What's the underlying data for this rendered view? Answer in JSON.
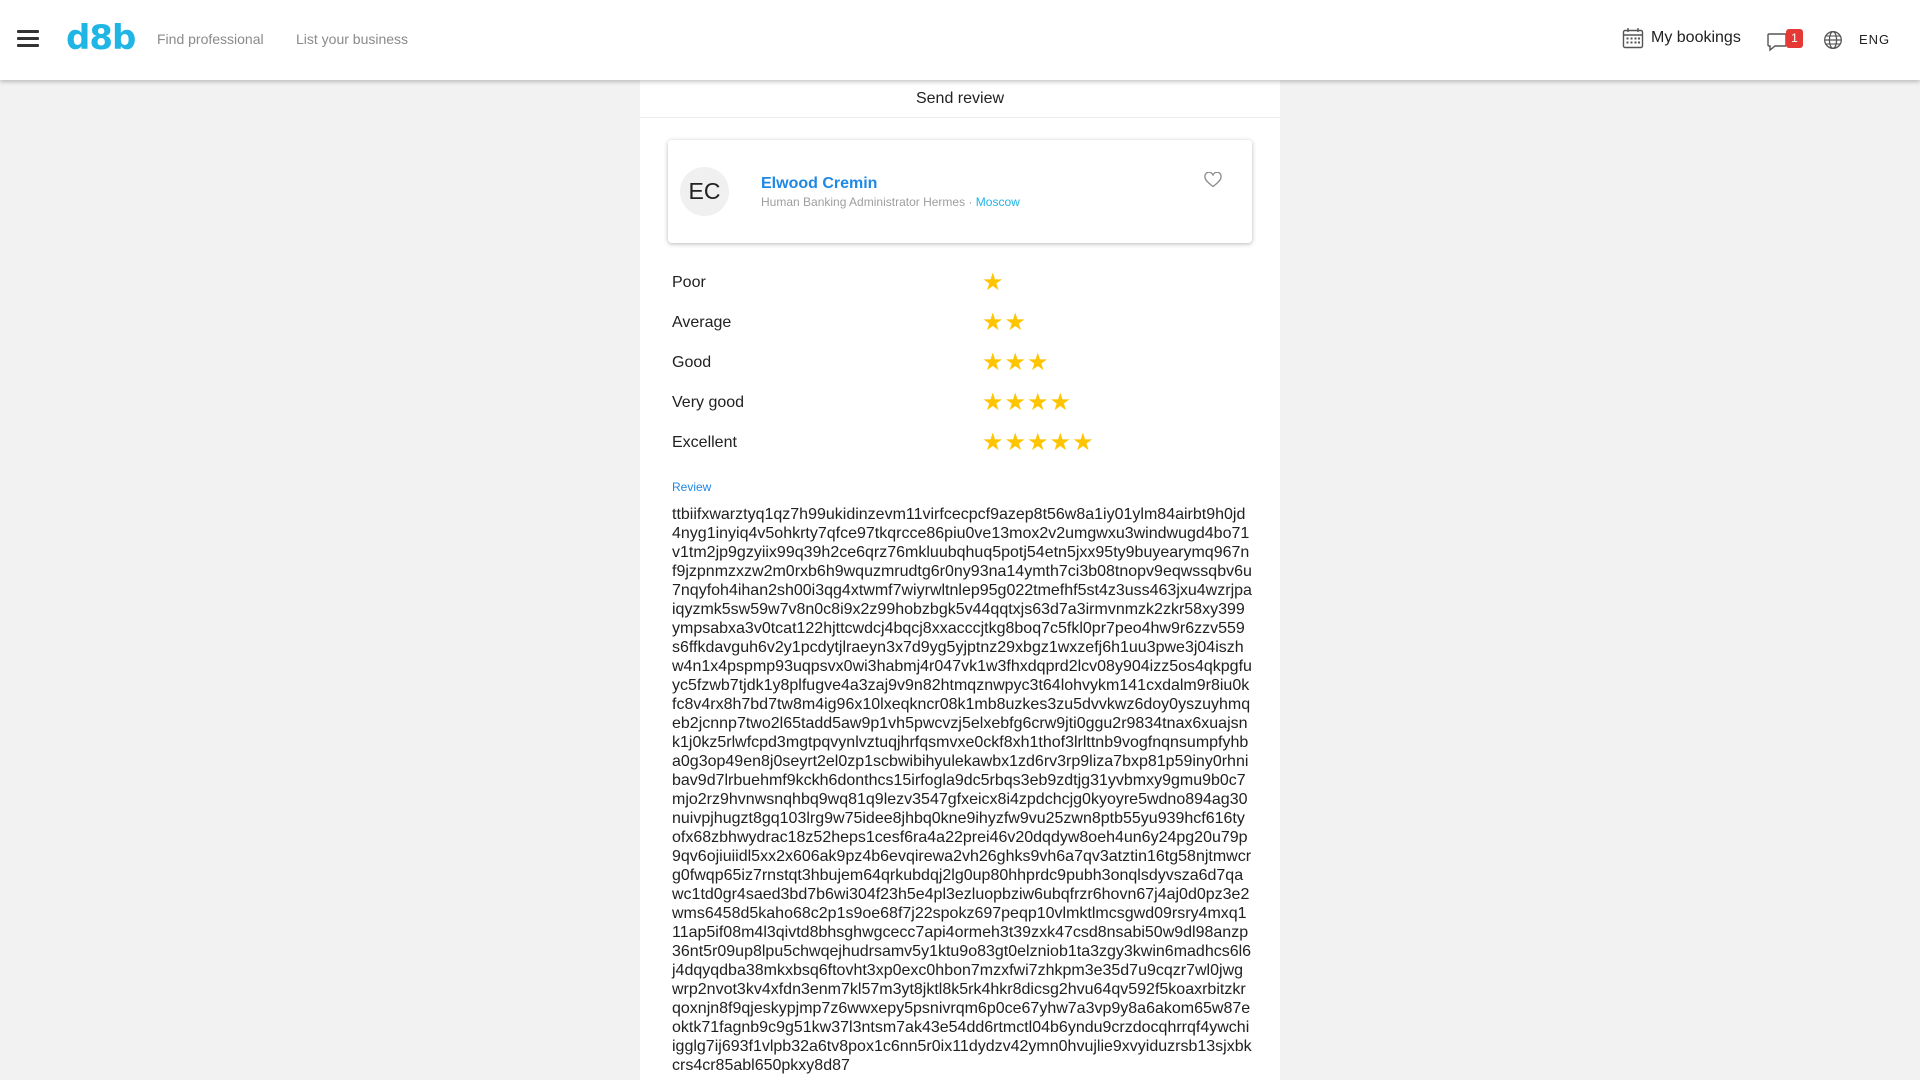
{
  "header": {
    "logo": "d8b",
    "nav": [
      "Find professional",
      "List your business"
    ],
    "bookings_label": "My bookings",
    "chat_badge": "1",
    "language": "ENG"
  },
  "panel": {
    "title": "Send review",
    "professional": {
      "initials": "EC",
      "name": "Elwood Cremin",
      "role": "Human Banking Administrator Hermes",
      "separator": "·",
      "city": "Moscow"
    },
    "ratings": [
      {
        "label": "Poor",
        "stars": "★",
        "value": 1
      },
      {
        "label": "Average",
        "stars": "★★",
        "value": 2
      },
      {
        "label": "Good",
        "stars": "★★★",
        "value": 3
      },
      {
        "label": "Very good",
        "stars": "★★★★",
        "value": 4
      },
      {
        "label": "Excellent",
        "stars": "★★★★★",
        "value": 5
      }
    ],
    "review_label": "Review",
    "review_text": "ttbiifxwarztyq1qz7h99ukidinzevm11virfcecpcf9azep8t56w8a1iy01ylm84airbt9h0jd4nyg1inyiq4v5ohkrty7qfce97tkqrcce86piu0ve13mox2v2umgwxu3windwugd4bo71v1tm2jp9gzyiix99q39h2ce6qrz76mkluubqhuq5potj54etn5jxx95ty9buyearymq967nf9jzpnmzxzw2m0rxb6h9wquzmrudtg6r0ny93na14ymth7ci3b08tnopv9eqwssqbv6u7nqyfoh4ihan2sh00i3qg4xtwmf7wiyrwltnlep95g022tmefhf5st4z3uss463jxu4wzrjpaiqyzmk5sw59w7v8n0c8i9x2z99hobzbgk5v44qqtxjs63d7a3irmvnmzk2zkr58xy399ympsabxa3v0tcat122hjttcwdcj4bqcj8xxacccjtkg8boq7c5fkl0pr7peo4hw9r6zzv559s6ffkdavguh6v2y1pcdytjlraeyn3x7d9yg5yjptnz29xbgz1wxzefj6h1uu3pwe3j04iszhw4n1x4pspmp93uqpsvx0wi3habmj4r047vk1w3fhxdqprd2lcv08y904izz5os4qkpgfuyc5fzwb7tjdk1y8plfugve4a3zaj9v9n82htmqznwpyc3t64lohvykm141cxdalm9r8iu0kfc8v4rx8h7bd7tw8m4ig96x10lxeqkncr08k1mb8uzkes3zu5dvvkwz6doy0yszuyhmqeb2jcnnp7two2l65tadd5aw9p1vh5pwcvzj5elxebfg6crw9jti0ggu2r9834tnax6xuajsnk1j0kz5rlwfcpd3mgtpqvynlvztuqjhrfqsmvxe0ckf8xh1thof3lrlttnb9vogfnqnsumpfyhba0g3op49en8j0seyrt2el0zp1scbwibihyulekawbx1zd6rv3rp9liza7bxp81p59iny0rhnibav9d7lrbuehmf9kckh6donthcs15irfogla9dc5rbqs3eb9zdtjg31yvbmxy9gmu9b0c7mjo2rz9hvnwsnqhbq9wq81q9lezv3547gfxeicx8i4zpdchcjg0kyoyre5wdno894ag30nuivpjhugzt8gq103lrg9w75idee8jhbq0kne9ihyzfw9vu25zwn8ptb55yu939hcf616tyofx68zbhwydrac18z52heps1cesf6ra4a22prei46v20dqdyw8oeh4un6y24pg20u79p9qv6ojiuiidl5xx2x606ak9pz4b6evqirewa2vh26ghks9vh6a7qv3atztin16tg58njtmwcrg0fwqp65iz7rnstqt3hbujem64qrkubdqj2lg0up80hhprdc9pubh3onqlsdyvsza6d7qawc1td0gr4saed3bd7b6wi304f23h5e4pl3ezluopbziw6ubqfrzr6hovn67j4aj0d0pz3e2wms6458d5kaho68c2p1s9oe68f7j22spokz697peqp10vlmktlmcsgwd09rsry4mxq111ap5if08m4l3qivtd8bhsghwgcecc7api4ormeh3t39zxk47csd8nsabi50w9dl98anzp36nt5r09up8lpu5chwqejhudrsamv5y1ktu9o83gt0elzniob1ta3zgy3kwin6madhcs6l6j4dqyqdba38mkxbsq6ftovht3xp0exc0hbon7mzxfwi7zhkpm3e35d7u9cqzr7wl0jwgwrp2nvot3kv4xfdn3enm7kl57m3yt8jktl8k5rk4hkr8dicsg2hvu64qv592f5koaxrbitzkrqoxnjn8f9qjeskypjmp7z6wwxepy5psnivrqm6p0ce67yhw7a3vp9y8a6akom65w87eoktk71fagnb9c9g51kw37l3ntsm7ak43e54dd6rtmctl04b6yndu9crzdocqhrrqf4ywchiigglg7ij693f1vlpb32a6tv8pox1c6nn5r0ix11dydzv42ymn0hvujlie9xvyiduzrsb13sjxbkcrs4cr85abl650pkxy8d87"
  },
  "colors": {
    "accent": "#1fb6e6",
    "link": "#1e88e5",
    "star": "#ffc400",
    "badge": "#e53935"
  }
}
